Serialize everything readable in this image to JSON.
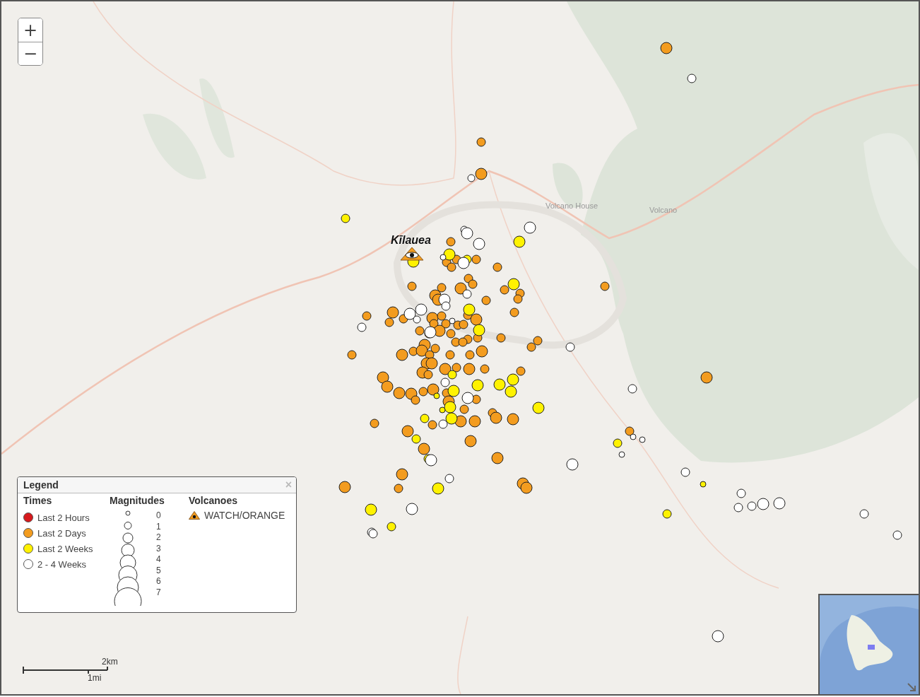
{
  "zoom_controls": {
    "zoom_in": "+",
    "zoom_out": "−"
  },
  "map_labels": [
    {
      "kind": "place",
      "text": "Volcano House"
    },
    {
      "kind": "place",
      "text": "Volcano"
    },
    {
      "kind": "volcano",
      "text": "Kīlauea"
    }
  ],
  "legend": {
    "title": "Legend",
    "close": "×",
    "times": {
      "heading": "Times",
      "items": [
        {
          "label": "Last 2 Hours",
          "color": "#d7191c"
        },
        {
          "label": "Last 2 Days",
          "color": "#f39c1f"
        },
        {
          "label": "Last 2 Weeks",
          "color": "#fff200"
        },
        {
          "label": "2 - 4 Weeks",
          "color": "#ffffff"
        }
      ]
    },
    "magnitudes": {
      "heading": "Magnitudes",
      "values": [
        "0",
        "1",
        "2",
        "3",
        "4",
        "5",
        "6",
        "7"
      ]
    },
    "volcanoes": {
      "heading": "Volcanoes",
      "items": [
        {
          "label": "WATCH/ORANGE"
        }
      ]
    }
  },
  "scale_bar": {
    "metric": "2km",
    "imperial": "1mi"
  }
}
